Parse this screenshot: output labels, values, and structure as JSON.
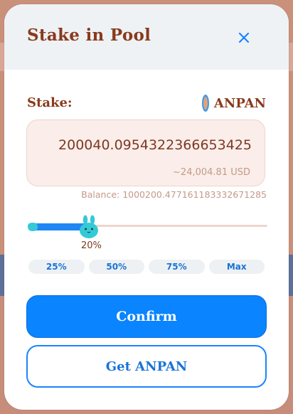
{
  "modal": {
    "title": "Stake in Pool",
    "stake_label": "Stake:",
    "token_name": "ANPAN",
    "amount": "200040.0954322366653425",
    "amount_usd": "~24,004.81 USD",
    "balance": "Balance: 1000200.477161183332671285",
    "slider": {
      "value_percent": 20,
      "label": "20%"
    },
    "quick_pcts": [
      "25%",
      "50%",
      "75%",
      "Max"
    ],
    "confirm_label": "Confirm",
    "get_label": "Get ANPAN"
  },
  "colors": {
    "title": "#8a3a1c",
    "accent": "#0a84ff",
    "slider_fill": "#1f86f3",
    "mascot": "#35c9d6"
  }
}
